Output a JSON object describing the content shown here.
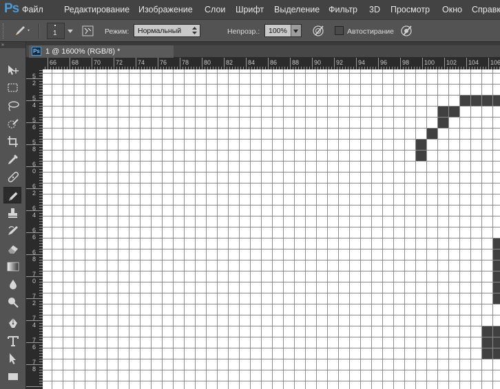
{
  "app": {
    "logo": "Ps"
  },
  "menu": [
    "Файл",
    "Редактирование",
    "Изображение",
    "Слои",
    "Шрифт",
    "Выделение",
    "Фильтр",
    "3D",
    "Просмотр",
    "Окно",
    "Справка"
  ],
  "options": {
    "brush_size": "1",
    "mode_label": "Режим:",
    "mode_value": "Нормальный",
    "opacity_label": "Непрозр.:",
    "opacity_value": "100%",
    "auto_erase_label": "Автостирание",
    "auto_erase_checked": false
  },
  "toolbar": {
    "collapse_glyph": "»",
    "tools": [
      "move-tool",
      "marquee-tool",
      "lasso-tool",
      "quick-select-tool",
      "crop-tool",
      "eyedropper-tool",
      "healing-tool",
      "pencil-tool",
      "stamp-tool",
      "history-brush-tool",
      "eraser-tool",
      "gradient-tool",
      "blur-tool",
      "dodge-tool",
      "pen-tool",
      "type-tool",
      "path-select-tool",
      "shape-tool"
    ],
    "active_tool": "pencil-tool"
  },
  "document": {
    "ps_badge": "Ps",
    "title": "1 @ 1600% (RGB/8) *"
  },
  "ruler": {
    "top_labels": [
      "66",
      "68",
      "70",
      "72",
      "74",
      "76",
      "78",
      "80",
      "82",
      "84",
      "86",
      "88",
      "90",
      "92",
      "94",
      "96",
      "98",
      "100",
      "102",
      "104",
      "106"
    ],
    "left_labels": [
      "52",
      "54",
      "56",
      "58",
      "60",
      "62",
      "64",
      "66",
      "68",
      "70",
      "72",
      "74",
      "76",
      "78"
    ]
  },
  "pixels": {
    "color": "#404040",
    "grid_color": "#8a8a8a",
    "cells": [
      [
        38,
        3
      ],
      [
        39,
        3
      ],
      [
        40,
        3
      ],
      [
        41,
        3
      ],
      [
        42,
        3
      ],
      [
        43,
        3
      ],
      [
        44,
        3
      ],
      [
        45,
        3
      ],
      [
        36,
        4
      ],
      [
        37,
        4
      ],
      [
        46,
        4
      ],
      [
        47,
        4
      ],
      [
        36,
        5
      ],
      [
        48,
        5
      ],
      [
        35,
        6
      ],
      [
        48,
        6
      ],
      [
        34,
        7
      ],
      [
        49,
        7
      ],
      [
        34,
        8
      ],
      [
        49,
        8
      ],
      [
        50,
        8
      ],
      [
        50,
        9
      ],
      [
        50,
        10
      ],
      [
        49,
        11
      ],
      [
        50,
        11
      ],
      [
        48,
        12
      ],
      [
        49,
        12
      ],
      [
        46,
        13
      ],
      [
        47,
        13
      ],
      [
        44,
        14
      ],
      [
        45,
        14
      ],
      [
        42,
        15
      ],
      [
        43,
        15
      ],
      [
        41,
        16
      ],
      [
        42,
        16
      ],
      [
        41,
        17
      ],
      [
        41,
        18
      ],
      [
        41,
        19
      ],
      [
        41,
        20
      ],
      [
        41,
        21
      ],
      [
        40,
        24
      ],
      [
        41,
        24
      ],
      [
        42,
        24
      ],
      [
        40,
        25
      ],
      [
        41,
        25
      ],
      [
        42,
        25
      ],
      [
        40,
        26
      ],
      [
        41,
        26
      ],
      [
        42,
        26
      ]
    ]
  }
}
